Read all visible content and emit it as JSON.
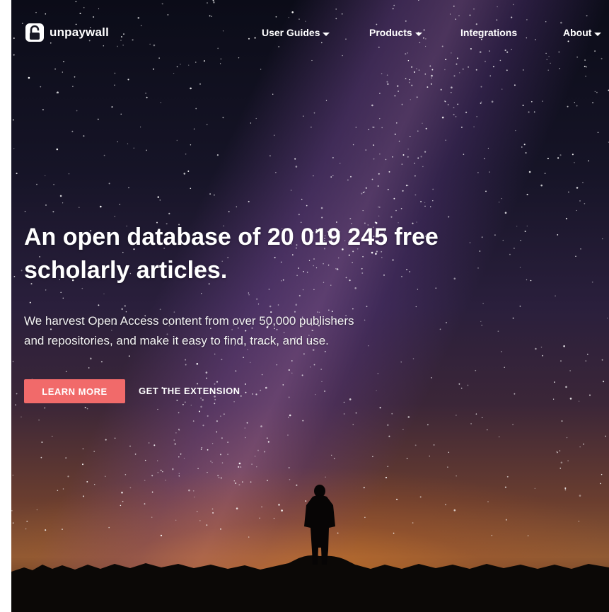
{
  "brand": {
    "name": "unpaywall",
    "logo_icon": "padlock-open-icon"
  },
  "nav": {
    "items": [
      {
        "label": "User Guides",
        "has_dropdown": true
      },
      {
        "label": "Products",
        "has_dropdown": true
      },
      {
        "label": "Integrations",
        "has_dropdown": false
      },
      {
        "label": "About",
        "has_dropdown": true
      }
    ]
  },
  "hero": {
    "title_line1": "An open database of 20 019 245 free",
    "title_line2": "scholarly articles.",
    "subtitle_line1": "We harvest Open Access content from over 50,000 publishers",
    "subtitle_line2": "and repositories, and make it easy to find, track, and use.",
    "primary_button": "LEARN MORE",
    "secondary_button": "GET THE EXTENSION"
  },
  "colors": {
    "accent": "#f16a6a",
    "text": "#ffffff",
    "sky_top": "#0b0c18",
    "horizon_glow": "#d67c2c"
  }
}
